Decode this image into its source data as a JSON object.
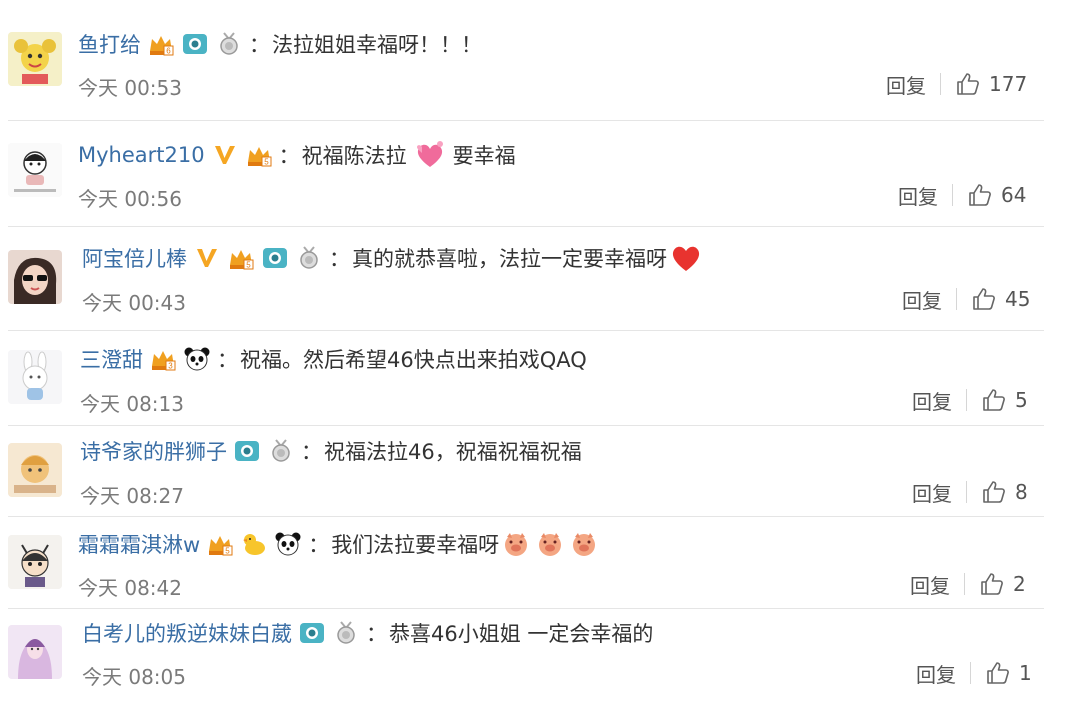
{
  "comments": [
    {
      "user": "鱼打给",
      "text": "法拉姐姐幸福呀！！！",
      "time": "今天 00:53",
      "reply": "回复",
      "likes": "177",
      "badges": [
        "crown-badge-icon",
        "camera-badge-icon",
        "medal-badge-icon"
      ],
      "emojis": []
    },
    {
      "user": "Myheart210",
      "text_before": "祝福陈法拉",
      "text_after": "要幸福",
      "time": "今天 00:56",
      "reply": "回复",
      "likes": "64",
      "badges": [
        "verified-v-icon",
        "crown-badge-icon"
      ],
      "emojis": [
        "hearts-emoji-icon"
      ]
    },
    {
      "user": "阿宝倍儿棒",
      "text": "真的就恭喜啦，法拉一定要幸福呀",
      "time": "今天 00:43",
      "reply": "回复",
      "likes": "45",
      "badges": [
        "verified-v-icon",
        "crown-badge-icon",
        "camera-badge-icon",
        "medal-badge-icon"
      ],
      "emojis": [
        "red-heart-emoji-icon"
      ]
    },
    {
      "user": "三澄甜",
      "text": "祝福。然后希望46快点出来拍戏QAQ",
      "time": "今天 08:13",
      "reply": "回复",
      "likes": "5",
      "badges": [
        "crown-badge-icon",
        "panda-badge-icon"
      ],
      "emojis": []
    },
    {
      "user": "诗爷家的胖狮子",
      "text": "祝福法拉46，祝福祝福祝福",
      "time": "今天 08:27",
      "reply": "回复",
      "likes": "8",
      "badges": [
        "camera-badge-icon",
        "medal-badge-icon"
      ],
      "emojis": []
    },
    {
      "user": "霜霜霜淇淋w",
      "text": "我们法拉要幸福呀",
      "time": "今天 08:42",
      "reply": "回复",
      "likes": "2",
      "badges": [
        "crown-badge-icon",
        "duck-badge-icon",
        "panda-badge-icon"
      ],
      "emojis": [
        "pig-emoji-icon",
        "pig-emoji-icon",
        "pig-emoji-icon"
      ]
    },
    {
      "user": "白考儿的叛逆妹妹白葳",
      "text": "恭喜46小姐姐 一定会幸福的",
      "time": "今天 08:05",
      "reply": "回复",
      "likes": "1",
      "badges": [
        "camera-badge-icon",
        "medal-badge-icon"
      ],
      "emojis": []
    }
  ],
  "colors": {
    "username": "#3a6ea5",
    "text": "#333333",
    "meta": "#7a7a7a",
    "divider": "#e5e5e5",
    "accent_orange": "#f0a020",
    "heart_red": "#e8332f"
  }
}
